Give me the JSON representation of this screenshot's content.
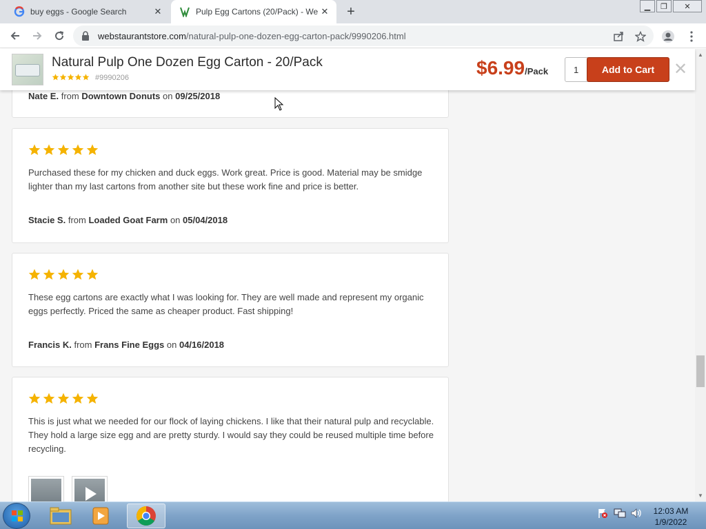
{
  "browser": {
    "tabs": [
      {
        "title": "buy eggs - Google Search",
        "active": false
      },
      {
        "title": "Pulp Egg Cartons (20/Pack) - We",
        "active": true
      }
    ],
    "url_domain": "webstaurantstore.com",
    "url_path": "/natural-pulp-one-dozen-egg-carton-pack/9990206.html"
  },
  "product": {
    "title": "Natural Pulp One Dozen Egg Carton - 20/Pack",
    "item_number": "#9990206",
    "rating": 5,
    "price": "$6.99",
    "price_unit": "/Pack",
    "quantity": "1",
    "add_to_cart_label": "Add to Cart"
  },
  "reviews": [
    {
      "author": "Nate E.",
      "from_label": "from",
      "business": "Downtown Donuts",
      "on_label": "on",
      "date": "09/25/2018"
    },
    {
      "rating": 5,
      "text": "Purchased these for my chicken and duck eggs. Work great. Price is good. Material may be smidge lighter than my last cartons from another site but these work fine and price is better.",
      "author": "Stacie S.",
      "from_label": "from",
      "business": "Loaded Goat Farm",
      "on_label": "on",
      "date": "05/04/2018"
    },
    {
      "rating": 5,
      "text": "These egg cartons are exactly what I was looking for. They are well made and represent my organic eggs perfectly. Priced the same as cheaper product. Fast shipping!",
      "author": "Francis K.",
      "from_label": "from",
      "business": "Frans Fine Eggs",
      "on_label": "on",
      "date": "04/16/2018"
    },
    {
      "rating": 5,
      "text": "This is just what we needed for our flock of laying chickens. I like that their natural pulp and recyclable. They hold a large size egg and are pretty sturdy. I would say they could be reused multiple time before recycling."
    }
  ],
  "taskbar": {
    "time": "12:03 AM",
    "date": "1/9/2022"
  },
  "colors": {
    "accent_red": "#c8401b",
    "star_gold": "#f5b301"
  }
}
